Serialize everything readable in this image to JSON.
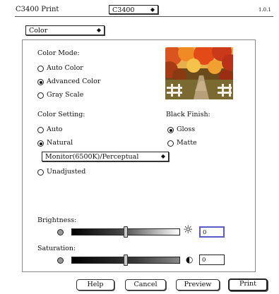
{
  "header": {
    "title": "C3400 Print",
    "printer_value": "C3400",
    "version": "1.0.1",
    "panel_value": "Color"
  },
  "color_mode": {
    "label": "Color Mode:",
    "options": [
      "Auto Color",
      "Advanced Color",
      "Gray Scale"
    ],
    "selected": "Advanced Color"
  },
  "color_setting": {
    "label": "Color Setting:",
    "options": [
      "Auto",
      "Natural",
      "Unadjusted"
    ],
    "selected": "Natural",
    "profile_value": "Monitor(6500K)/Perceptual"
  },
  "black_finish": {
    "label": "Black Finish:",
    "options": [
      "Gloss",
      "Matte"
    ],
    "selected": "Gloss"
  },
  "brightness": {
    "label": "Brightness:",
    "value": "0",
    "slider_fraction": 0.5
  },
  "saturation": {
    "label": "Saturation:",
    "value": "0",
    "slider_fraction": 0.5
  },
  "buttons": {
    "help": "Help",
    "cancel": "Cancel",
    "preview": "Preview",
    "print": "Print"
  },
  "icons": {
    "down_arrow": "◆",
    "sun": "☼",
    "contrast": "◐"
  }
}
